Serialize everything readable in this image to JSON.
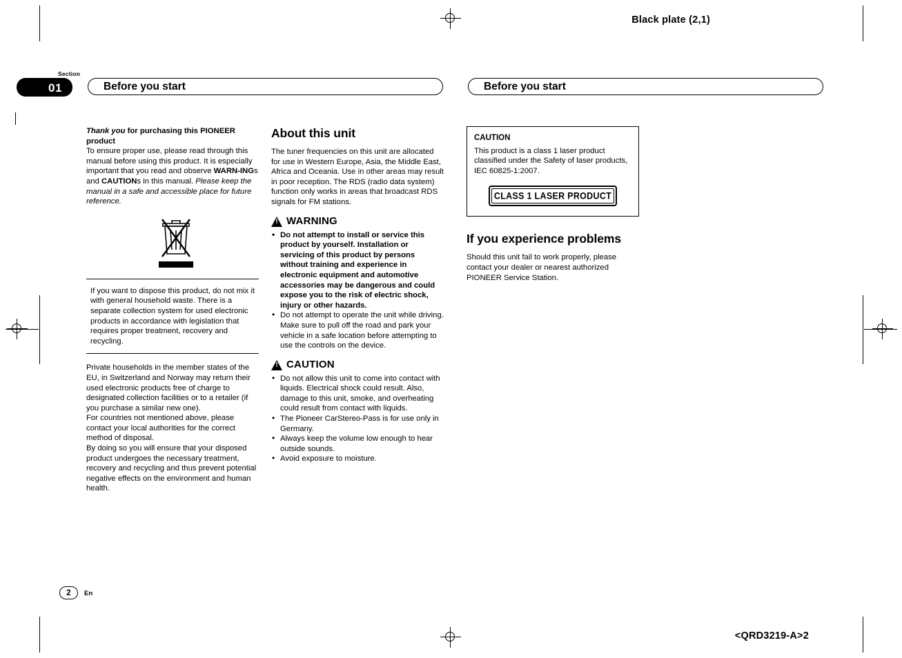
{
  "plate": {
    "top_right": "Black plate (2,1)",
    "bottom_right": "<QRD3219-A>2"
  },
  "section": {
    "label": "Section",
    "number": "01"
  },
  "running_head": {
    "left": "Before you start",
    "right": "Before you start"
  },
  "column1": {
    "intro_lead": "Thank you",
    "intro_lead_bold": " for purchasing this PIONEER product",
    "intro_body_1": "To ensure proper use, please read through this manual before using this product. It is especially important that you read and observe ",
    "intro_warn": "WARN-ING",
    "intro_body_2": "s and ",
    "intro_caution": "CAUTION",
    "intro_body_3": "s in this manual. ",
    "intro_italic": "Please keep the manual in a safe and accessible place for future reference.",
    "weee_icon": "crossed-out-wheeled-bin-icon",
    "disposal_box": "If you want to dispose this product, do not mix it with general household waste. There is a separate collection system for used electronic products in accordance with legislation that requires proper treatment, recovery and recycling.",
    "para_eu_1": "Private households in the member states of the EU, in Switzerland and Norway may return their used electronic products free of charge to designated collection facilities or to a retailer (if you purchase a similar new one).",
    "para_eu_2": "For countries not mentioned above, please contact your local authorities for the correct method of disposal.",
    "para_eu_3": "By doing so you will ensure that your disposed product undergoes the necessary treatment, recovery and recycling and thus prevent potential negative effects on the environment and human health."
  },
  "column2": {
    "heading": "About this unit",
    "body": "The tuner frequencies on this unit are allocated for use in Western Europe, Asia, the Middle East, Africa and Oceania. Use in other areas may result in poor reception. The RDS (radio data system) function only works in areas that broadcast RDS signals for FM stations.",
    "warning_label": "WARNING",
    "warning_items": [
      "Do not attempt to install or service this product by yourself. Installation or servicing of this product by persons without training and experience in electronic equipment and automotive accessories may be dangerous and could expose you to the risk of electric shock, injury or other hazards.",
      "Do not attempt to operate the unit while driving. Make sure to pull off the road and park your vehicle in a safe location before attempting to use the controls on the device."
    ],
    "caution_label": "CAUTION",
    "caution_items": [
      "Do not allow this unit to come into contact with liquids. Electrical shock could result. Also, damage to this unit, smoke, and overheating could result from contact with liquids.",
      "The Pioneer CarStereo-Pass is for use only in Germany.",
      "Always keep the volume low enough to hear outside sounds.",
      "Avoid exposure to moisture."
    ]
  },
  "column3": {
    "caution_box_title": "CAUTION",
    "caution_box_body": "This product is a class 1 laser product classified under the Safety of laser products, IEC 60825-1:2007.",
    "laser_label": "CLASS 1 LASER PRODUCT",
    "heading": "If you experience problems",
    "body": "Should this unit fail to work properly, please contact your dealer or nearest authorized PIONEER Service Station."
  },
  "footer": {
    "page_number": "2",
    "language": "En"
  }
}
